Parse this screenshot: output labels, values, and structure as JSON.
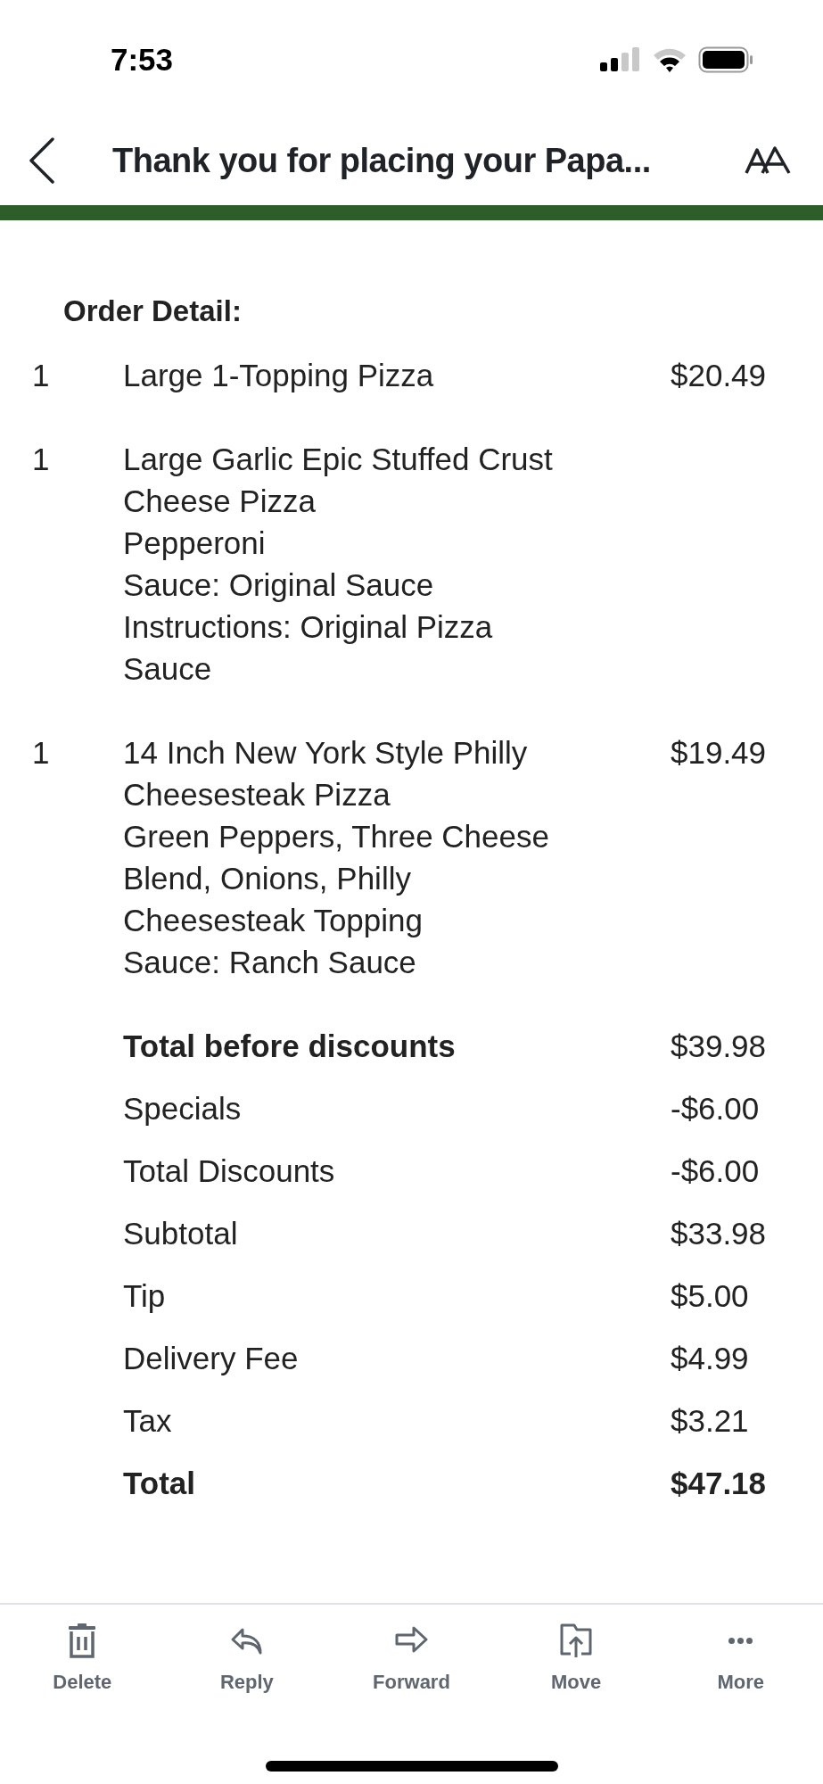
{
  "status_bar": {
    "time": "7:53"
  },
  "header": {
    "title": "Thank you for placing your Papa..."
  },
  "order_detail": {
    "heading": "Order Detail:",
    "items": [
      {
        "quantity": "1",
        "lines": [
          "Large 1-Topping Pizza"
        ],
        "price": "$20.49"
      },
      {
        "quantity": "1",
        "lines": [
          "Large Garlic Epic Stuffed Crust",
          "Cheese Pizza",
          "Pepperoni",
          "Sauce: Original Sauce",
          "Instructions: Original Pizza",
          "Sauce"
        ]
      },
      {
        "quantity": "1",
        "lines": [
          "14 Inch New York Style Philly",
          "Cheesesteak Pizza",
          "Green Peppers, Three Cheese",
          "Blend, Onions, Philly",
          "Cheesesteak Topping",
          "Sauce: Ranch Sauce"
        ],
        "price": "$19.49"
      }
    ],
    "summary": [
      {
        "label": "Total before discounts",
        "value": "$39.98",
        "bold_label": true,
        "bold_value": false
      },
      {
        "label": "Specials",
        "value": "-$6.00",
        "bold_label": false,
        "bold_value": false
      },
      {
        "label": "Total Discounts",
        "value": "-$6.00",
        "bold_label": false,
        "bold_value": false
      },
      {
        "label": "Subtotal",
        "value": "$33.98",
        "bold_label": false,
        "bold_value": false
      },
      {
        "label": "Tip",
        "value": "$5.00",
        "bold_label": false,
        "bold_value": false
      },
      {
        "label": "Delivery Fee",
        "value": "$4.99",
        "bold_label": false,
        "bold_value": false
      },
      {
        "label": "Tax",
        "value": "$3.21",
        "bold_label": false,
        "bold_value": false
      },
      {
        "label": "Total",
        "value": "$47.18",
        "bold_label": true,
        "bold_value": true
      }
    ]
  },
  "toolbar": [
    {
      "kind": "delete",
      "label": "Delete"
    },
    {
      "kind": "reply",
      "label": "Reply"
    },
    {
      "kind": "forward",
      "label": "Forward"
    },
    {
      "kind": "move",
      "label": "Move"
    },
    {
      "kind": "more",
      "label": "More"
    }
  ]
}
